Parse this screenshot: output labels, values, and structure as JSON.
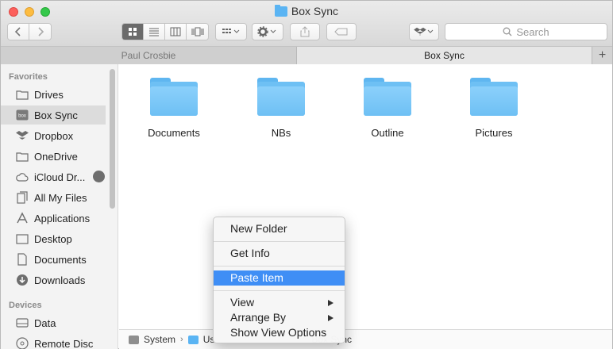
{
  "window": {
    "title": "Box Sync"
  },
  "toolbar": {
    "back_icon": "chevron-left-icon",
    "forward_icon": "chevron-right-icon",
    "view_modes": [
      "icon-view-icon",
      "list-view-icon",
      "column-view-icon",
      "coverflow-view-icon"
    ],
    "active_view": "icon-view-icon",
    "search_placeholder": "Search"
  },
  "tabs": [
    {
      "label": "Paul Crosbie",
      "active": false
    },
    {
      "label": "Box Sync",
      "active": true
    }
  ],
  "sidebar": {
    "favorites_header": "Favorites",
    "favorites": [
      {
        "label": "Drives",
        "icon": "folder-icon"
      },
      {
        "label": "Box Sync",
        "icon": "box-icon",
        "selected": true
      },
      {
        "label": "Dropbox",
        "icon": "dropbox-icon"
      },
      {
        "label": "OneDrive",
        "icon": "folder-icon"
      },
      {
        "label": "iCloud Dr...",
        "icon": "cloud-icon"
      },
      {
        "label": "All My Files",
        "icon": "files-icon"
      },
      {
        "label": "Applications",
        "icon": "applications-icon"
      },
      {
        "label": "Desktop",
        "icon": "desktop-icon"
      },
      {
        "label": "Documents",
        "icon": "document-icon"
      },
      {
        "label": "Downloads",
        "icon": "download-icon"
      }
    ],
    "devices_header": "Devices",
    "devices": [
      {
        "label": "Data",
        "icon": "disk-icon"
      },
      {
        "label": "Remote Disc",
        "icon": "disc-icon"
      }
    ]
  },
  "files": [
    {
      "label": "Documents"
    },
    {
      "label": "NBs"
    },
    {
      "label": "Outline"
    },
    {
      "label": "Pictures"
    }
  ],
  "context_menu": {
    "items": [
      {
        "label": "New Folder"
      },
      {
        "label": "Get Info"
      },
      {
        "label": "Paste Item",
        "highlighted": true
      },
      {
        "label": "View",
        "submenu": true
      },
      {
        "label": "Arrange By",
        "submenu": true
      },
      {
        "label": "Show View Options"
      }
    ]
  },
  "pathbar": {
    "items": [
      "System",
      "Us",
      "Box Sync"
    ]
  },
  "colors": {
    "accent": "#3f8ef5",
    "folder": "#6ec0f4"
  }
}
